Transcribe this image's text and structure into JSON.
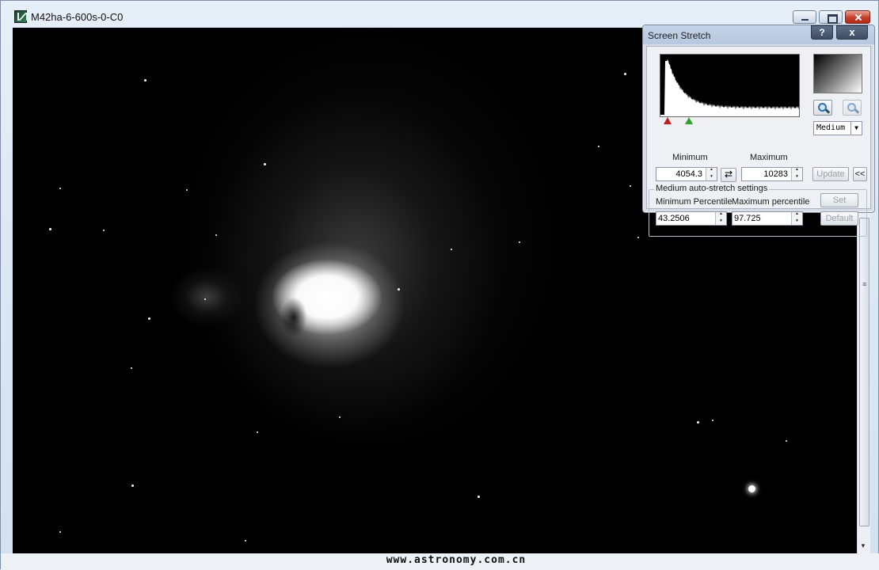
{
  "window": {
    "title": "M42ha-6-600s-0-C0"
  },
  "watermark": "www.astronomy.com.cn",
  "screen_stretch": {
    "title": "Screen Stretch",
    "help_label": "?",
    "close_label": "x",
    "minimum_label": "Minimum",
    "maximum_label": "Maximum",
    "minimum_value": "4054.3",
    "maximum_value": "10283",
    "preset_value": "Medium",
    "update_label": "Update",
    "collapse_label": "<<",
    "swap_label": "⇄",
    "group_title": "Medium auto-stretch settings",
    "min_percentile_label": "Minimum Percentile",
    "max_percentile_label": "Maximum percentile",
    "min_percentile_value": "43.2506",
    "max_percentile_value": "97.725",
    "set_label": "Set",
    "default_label": "Default",
    "colors": {
      "min_marker": "#c02020",
      "max_marker": "#30a030"
    }
  },
  "icons": {
    "app": "pixinsight-style-app-icon",
    "zoom_in": "zoom-in-icon",
    "zoom_out": "zoom-out-icon"
  }
}
